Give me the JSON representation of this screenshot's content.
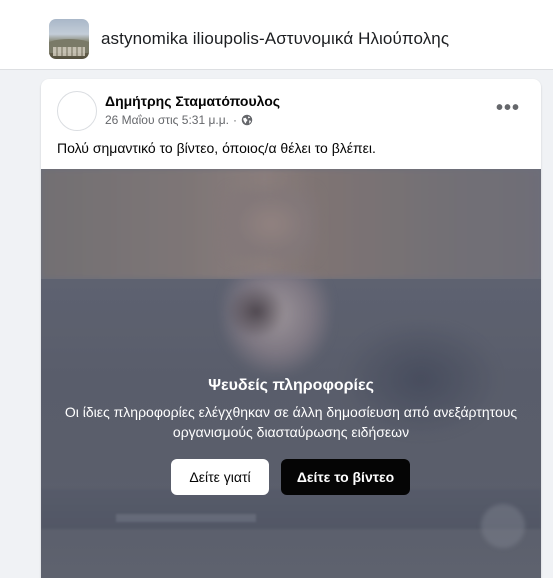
{
  "group": {
    "name": "astynomika ilioupolis-Αστυνομικά Ηλιούπολης"
  },
  "post": {
    "author": "Δημήτρης Σταματόπουλος",
    "timestamp": "26 Μαΐου στις 5:31 μ.μ.",
    "separator": "·",
    "privacy_icon": "globe-icon",
    "more_icon": "more-options-icon",
    "more_label": "•••",
    "text": "Πολύ σημαντικό το βίντεο, όποιος/α θέλει το βλέπει."
  },
  "warning": {
    "title": "Ψευδείς πληροφορίες",
    "body": "Οι ίδιες πληροφορίες ελέγχθηκαν σε άλλη δημοσίευση από ανεξάρτητους οργανισμούς διασταύρωσης ειδήσεων",
    "see_why_label": "Δείτε γιατί",
    "see_video_label": "Δείτε το βίντεο"
  },
  "colors": {
    "page_background": "#f0f2f5",
    "card_background": "#ffffff",
    "secondary_text": "#65676b",
    "primary_text": "#050505",
    "dark_button": "#050505"
  }
}
